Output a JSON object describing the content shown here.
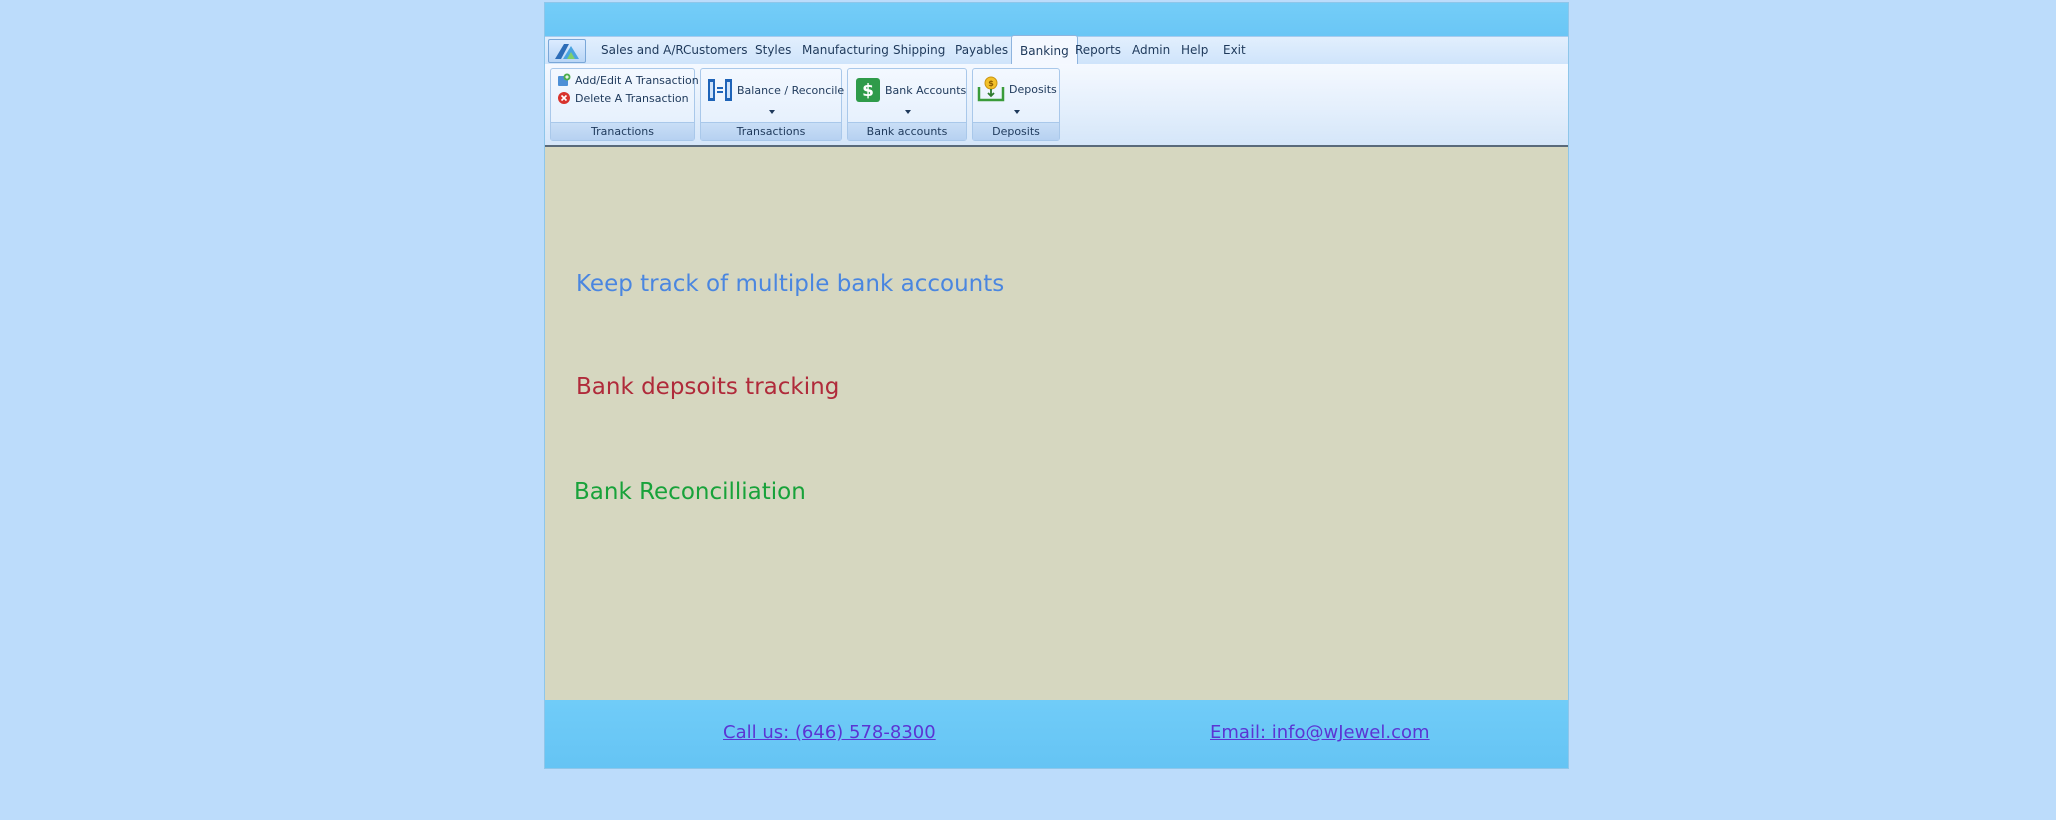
{
  "menu": {
    "items": [
      {
        "label": "Sales and A/R"
      },
      {
        "label": "Customers"
      },
      {
        "label": "Styles"
      },
      {
        "label": "Manufacturing"
      },
      {
        "label": "Shipping"
      },
      {
        "label": "Payables"
      },
      {
        "label": "Banking",
        "active": true
      },
      {
        "label": "Reports"
      },
      {
        "label": "Admin"
      },
      {
        "label": "Help"
      },
      {
        "label": "Exit"
      }
    ]
  },
  "ribbon": {
    "groups": [
      {
        "label": "Tranactions",
        "commands": [
          {
            "label": "Add/Edit A Transaction",
            "icon": "add-edit-transaction-icon"
          },
          {
            "label": "Delete A Transaction",
            "icon": "delete-icon"
          }
        ]
      },
      {
        "label": "Transactions",
        "commands": [
          {
            "label": "Balance / Reconcile",
            "icon": "balance-reconcile-icon"
          }
        ]
      },
      {
        "label": "Bank accounts",
        "commands": [
          {
            "label": "Bank Accounts",
            "icon": "dollar-icon"
          }
        ]
      },
      {
        "label": "Deposits",
        "commands": [
          {
            "label": "Deposits",
            "icon": "deposit-icon"
          }
        ]
      }
    ]
  },
  "content": {
    "features": [
      {
        "text": "Keep track of multiple bank accounts",
        "color": "#4a86e0"
      },
      {
        "text": "Bank depsoits tracking",
        "color": "#b02a3a"
      },
      {
        "text": "Bank Reconcilliation",
        "color": "#18a23a"
      }
    ]
  },
  "footer": {
    "phone": "Call us: (646) 578-8300",
    "email": "Email: info@wJewel.com"
  },
  "colors": {
    "page_bg": "#bcdcfb",
    "banner": "#6fcaf7",
    "content_bg": "#d6d7c0",
    "link": "#5b35d3"
  }
}
